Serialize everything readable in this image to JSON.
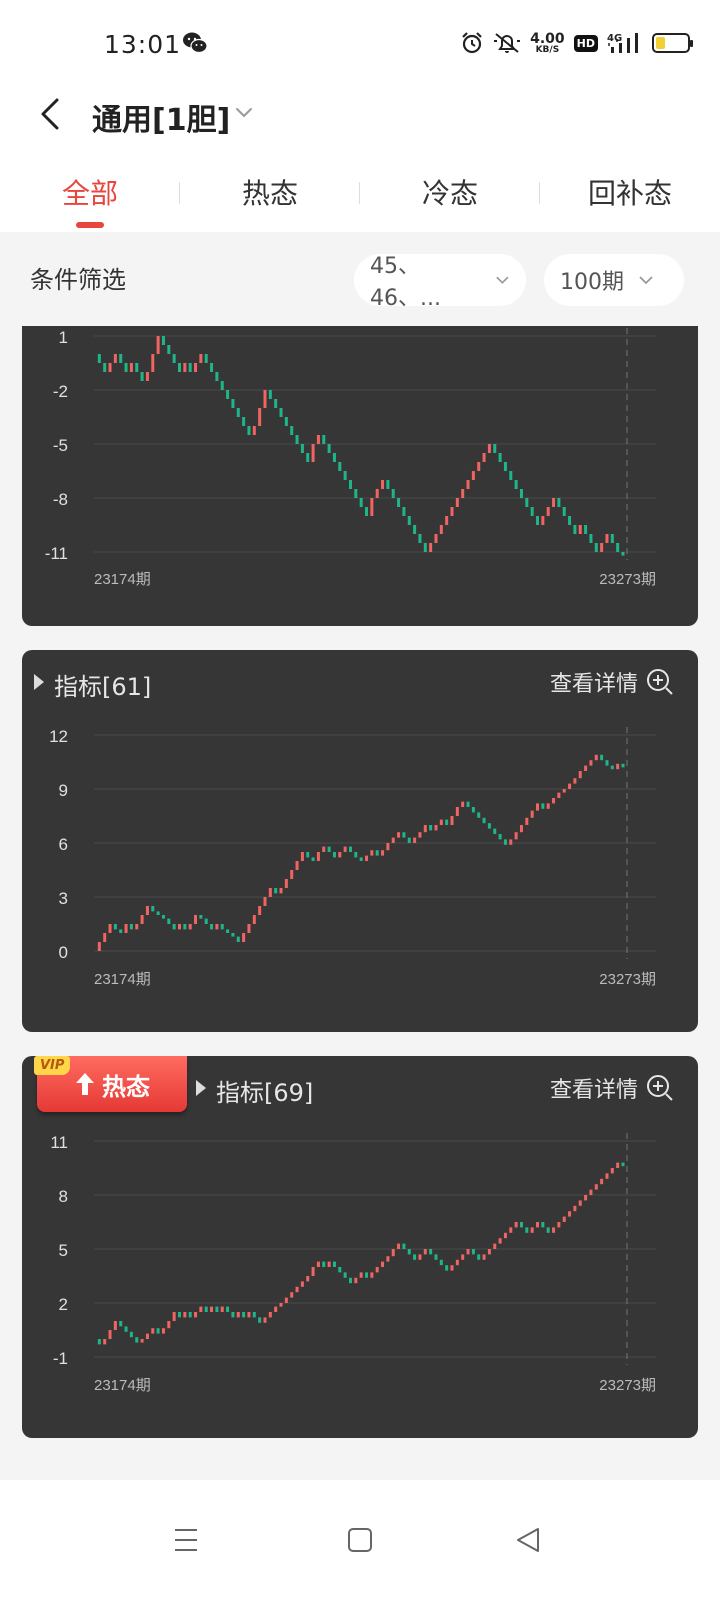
{
  "status_bar": {
    "time": "13:01",
    "net_speed_value": "4.00",
    "net_speed_unit": "KB/S",
    "hd_label": "HD",
    "network_label": "4G",
    "battery_level": 0.25,
    "icons": [
      "wechat-icon",
      "alarm-icon",
      "mute-icon",
      "signal-icon",
      "battery-icon"
    ]
  },
  "header": {
    "title": "通用[1胆]",
    "back_icon": "chevron-left-icon",
    "dropdown_icon": "chevron-down-icon"
  },
  "tabs": [
    {
      "label": "全部",
      "active": true
    },
    {
      "label": "热态",
      "active": false
    },
    {
      "label": "冷态",
      "active": false
    },
    {
      "label": "回补态",
      "active": false
    }
  ],
  "filter": {
    "label": "条件筛选",
    "selection_value": "45、46、...",
    "period_value": "100期"
  },
  "cards": [
    {
      "title": "",
      "detail_label": "",
      "badge": null
    },
    {
      "title": "指标[61]",
      "detail_label": "查看详情",
      "badge": null
    },
    {
      "title": "指标[69]",
      "detail_label": "查看详情",
      "badge": {
        "vip": "VIP",
        "label": "热态"
      }
    }
  ],
  "chart_data": [
    {
      "type": "line",
      "style": "candlestick-steps",
      "y_ticks": [
        "1",
        "-2",
        "-5",
        "-8",
        "-11"
      ],
      "ylim": [
        -11,
        1
      ],
      "x_start_label": "23174期",
      "x_end_label": "23273期",
      "series": [
        {
          "values": [
            0,
            -0.5,
            -1,
            -0.5,
            0,
            -0.5,
            -1,
            -0.5,
            -1,
            -1.5,
            -1,
            0,
            1,
            0.5,
            0,
            -0.5,
            -1,
            -0.5,
            -1,
            -0.5,
            0,
            -0.5,
            -1,
            -1.5,
            -2,
            -2.5,
            -3,
            -3.5,
            -4,
            -4.5,
            -4,
            -3,
            -2,
            -2.5,
            -3,
            -3.5,
            -4,
            -4.5,
            -5,
            -5.5,
            -6,
            -5,
            -4.5,
            -5,
            -5.5,
            -6,
            -6.5,
            -7,
            -7.5,
            -8,
            -8.5,
            -9,
            -8,
            -7.5,
            -7,
            -7.5,
            -8,
            -8.5,
            -9,
            -9.5,
            -10,
            -10.5,
            -11,
            -10.5,
            -10,
            -9.5,
            -9,
            -8.5,
            -8,
            -7.5,
            -7,
            -6.5,
            -6,
            -5.5,
            -5,
            -5.5,
            -6,
            -6.5,
            -7,
            -7.5,
            -8,
            -8.5,
            -9,
            -9.5,
            -9,
            -8.5,
            -8,
            -8.5,
            -9,
            -9.5,
            -10,
            -9.5,
            -10,
            -10.5,
            -11,
            -10.5,
            -10,
            -10.5,
            -11,
            -11.2
          ]
        }
      ]
    },
    {
      "type": "line",
      "style": "candlestick-steps",
      "y_ticks": [
        "12",
        "9",
        "6",
        "3",
        "0"
      ],
      "ylim": [
        0,
        12
      ],
      "x_start_label": "23174期",
      "x_end_label": "23273期",
      "series": [
        {
          "values": [
            0,
            0.5,
            1,
            1.5,
            1.2,
            1,
            1.5,
            1.2,
            1.5,
            2,
            2.5,
            2.2,
            2,
            1.8,
            1.5,
            1.2,
            1.5,
            1.2,
            1.5,
            2,
            1.8,
            1.5,
            1.2,
            1.5,
            1.2,
            1,
            0.8,
            0.5,
            1,
            1.5,
            2,
            2.5,
            3,
            3.5,
            3.2,
            3.5,
            4,
            4.5,
            5,
            5.5,
            5.2,
            5,
            5.5,
            5.8,
            5.5,
            5.2,
            5.5,
            5.8,
            5.5,
            5.2,
            5,
            5.3,
            5.6,
            5.3,
            5.6,
            6,
            6.3,
            6.6,
            6.3,
            6,
            6.3,
            6.6,
            7,
            6.7,
            7,
            7.3,
            7,
            7.5,
            8,
            8.3,
            8,
            7.7,
            7.4,
            7.1,
            6.8,
            6.5,
            6.2,
            5.9,
            6.2,
            6.6,
            7,
            7.4,
            7.8,
            8.2,
            7.9,
            8.2,
            8.5,
            8.8,
            9,
            9.3,
            9.6,
            10,
            10.3,
            10.6,
            10.9,
            10.6,
            10.3,
            10.1,
            10.4,
            10.2
          ]
        }
      ]
    },
    {
      "type": "line",
      "style": "candlestick-steps",
      "y_ticks": [
        "11",
        "8",
        "5",
        "2",
        "-1"
      ],
      "ylim": [
        -1,
        11
      ],
      "x_start_label": "23174期",
      "x_end_label": "23273期",
      "series": [
        {
          "values": [
            0,
            -0.3,
            0,
            0.5,
            1,
            0.7,
            0.4,
            0.1,
            -0.2,
            0,
            0.3,
            0.6,
            0.3,
            0.6,
            1,
            1.5,
            1.2,
            1.5,
            1.2,
            1.5,
            1.8,
            1.5,
            1.8,
            1.5,
            1.8,
            1.5,
            1.2,
            1.5,
            1.2,
            1.5,
            1.2,
            0.9,
            1.2,
            1.5,
            1.8,
            2,
            2.3,
            2.6,
            2.9,
            3.2,
            3.5,
            4,
            4.3,
            4,
            4.3,
            4,
            3.7,
            3.4,
            3.1,
            3.4,
            3.7,
            3.4,
            3.7,
            4,
            4.3,
            4.6,
            5,
            5.3,
            5,
            4.7,
            4.4,
            4.7,
            5,
            4.7,
            4.4,
            4.1,
            3.8,
            4.1,
            4.4,
            4.7,
            5,
            4.7,
            4.4,
            4.7,
            5,
            5.3,
            5.6,
            5.9,
            6.2,
            6.5,
            6.2,
            5.9,
            6.2,
            6.5,
            6.2,
            5.9,
            6.2,
            6.5,
            6.8,
            7.1,
            7.4,
            7.7,
            8,
            8.3,
            8.6,
            8.9,
            9.2,
            9.5,
            9.8,
            9.6
          ]
        }
      ]
    }
  ],
  "colors": {
    "accent": "#e8453c",
    "up": "#f06462",
    "down": "#1fb58a",
    "card_bg": "#363636"
  },
  "nav": {
    "icons": [
      "menu-icon",
      "home-icon",
      "back-icon"
    ]
  }
}
